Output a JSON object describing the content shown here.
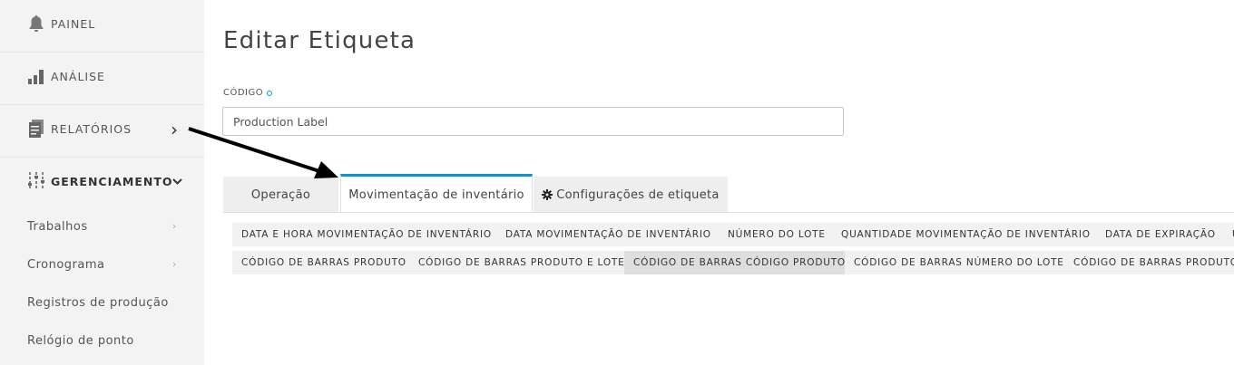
{
  "sidebar": {
    "painel": "PAINEL",
    "analise": "ANÁLISE",
    "relatorios": "RELATÓRIOS",
    "gerenciamento": "GERENCIAMENTO",
    "chevron_right": "›",
    "chevron_down": "⌄",
    "sub_items": [
      {
        "label": "Trabalhos",
        "has_chevron": true
      },
      {
        "label": "Cronograma",
        "has_chevron": true
      },
      {
        "label": "Registros de produção",
        "has_chevron": false
      },
      {
        "label": "Relógio de ponto",
        "has_chevron": false
      }
    ],
    "sub_chevron": "›"
  },
  "page": {
    "title": "Editar Etiqueta",
    "code_label": "CÓDIGO",
    "code_value": "Production Label"
  },
  "tabs": [
    {
      "label": "Operação"
    },
    {
      "label": "Movimentação de inventário"
    },
    {
      "label": "Configurações de etiqueta",
      "icon": "gear-icon"
    }
  ],
  "chips_row1": [
    "DATA E HORA MOVIMENTAÇÃO DE INVENTÁRIO",
    "DATA MOVIMENTAÇÃO DE INVENTÁRIO",
    "NÚMERO DO LOTE",
    "QUANTIDADE MOVIMENTAÇÃO DE INVENTÁRIO",
    "DATA DE EXPIRAÇÃO",
    "U"
  ],
  "chips_row2": [
    "CÓDIGO DE BARRAS PRODUTO",
    "CÓDIGO DE BARRAS PRODUTO E LOTE",
    "CÓDIGO DE BARRAS CÓDIGO PRODUTO",
    "CÓDIGO DE BARRAS NÚMERO DO LOTE",
    "CÓDIGO DE BARRAS PRODUTO E"
  ],
  "colors": {
    "accent": "#0696d7",
    "sidebar_bg": "#f3f3f3"
  }
}
